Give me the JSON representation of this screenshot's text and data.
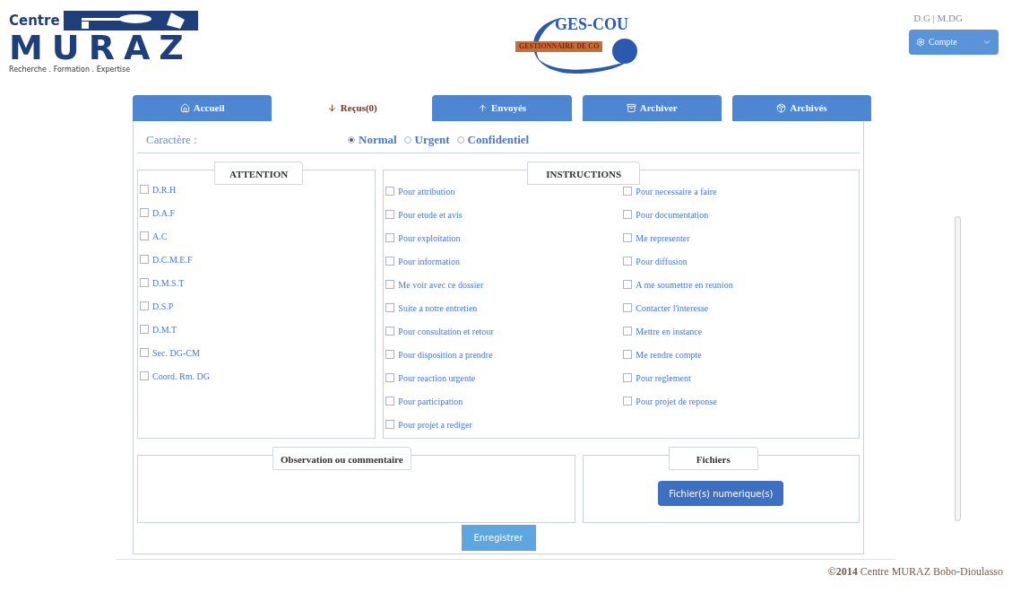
{
  "logo_left": {
    "line1": "Centre",
    "line2": "MURAZ",
    "tagline": "Recherche . Formation . Expertise"
  },
  "logo_center": {
    "title": "GES-COU",
    "subtitle": "GESTIONNAIRE DE CO"
  },
  "user": {
    "label": "D.G | M.DG",
    "menu_button": "Compte"
  },
  "tabs": [
    {
      "label": "Accueil",
      "selected": false
    },
    {
      "label": "Reçus(0)",
      "selected": true
    },
    {
      "label": "Envoyés",
      "selected": false
    },
    {
      "label": "Archiver",
      "selected": false
    },
    {
      "label": "Archivés",
      "selected": false
    }
  ],
  "caractere": {
    "label": "Caractère :",
    "options": [
      {
        "label": "Normal",
        "selected": true
      },
      {
        "label": "Urgent",
        "selected": false
      },
      {
        "label": "Confidentiel",
        "selected": false
      }
    ]
  },
  "attention": {
    "legend": "ATTENTION",
    "items": [
      {
        "label": "D.R.H",
        "checked": false
      },
      {
        "label": "D.A.F",
        "checked": false
      },
      {
        "label": "A.C",
        "checked": false
      },
      {
        "label": "D.C.M.E.F",
        "checked": false
      },
      {
        "label": "D.M.S.T",
        "checked": false
      },
      {
        "label": "D.S.P",
        "checked": false
      },
      {
        "label": "D.M.T",
        "checked": false
      },
      {
        "label": "Sec. DG-CM",
        "checked": false
      },
      {
        "label": "Coord. Rm. DG",
        "checked": false
      }
    ]
  },
  "instructions": {
    "legend": "INSTRUCTIONS",
    "column_1": [
      {
        "label": "Pour attribution",
        "checked": false
      },
      {
        "label": "Pour etude et avis",
        "checked": false
      },
      {
        "label": "Pour exploitation",
        "checked": false
      },
      {
        "label": "Pour information",
        "checked": false
      },
      {
        "label": "Me voir avec ce dossier",
        "checked": false
      },
      {
        "label": "Suite a notre entretien",
        "checked": false
      },
      {
        "label": "Pour consultation et retour",
        "checked": false
      },
      {
        "label": "Pour disposition a prendre",
        "checked": false
      },
      {
        "label": "Pour reaction urgente",
        "checked": false
      },
      {
        "label": "Pour participation",
        "checked": false
      },
      {
        "label": "Pour projet a rediger",
        "checked": false
      }
    ],
    "column_2": [
      {
        "label": "Pour necessaire a faire",
        "checked": false
      },
      {
        "label": "Pour documentation",
        "checked": false
      },
      {
        "label": "Me representer",
        "checked": false
      },
      {
        "label": "Pour diffusion",
        "checked": false
      },
      {
        "label": "A me soumettre en reunion",
        "checked": false
      },
      {
        "label": "Contacter l'interesse",
        "checked": false
      },
      {
        "label": "Mettre en instance",
        "checked": false
      },
      {
        "label": "Me rendre compte",
        "checked": false
      },
      {
        "label": "Pour reglement",
        "checked": false
      },
      {
        "label": "Pour projet de reponse",
        "checked": false
      }
    ]
  },
  "observation": {
    "legend": "Observation ou commentaire"
  },
  "fichiers": {
    "legend": "Fichiers",
    "button": "Fichier(s) numerique(s)"
  },
  "save_button": "Enregistrer",
  "footer": {
    "year": "©2014",
    "text": "Centre MURAZ Bobo-Dioulasso"
  }
}
